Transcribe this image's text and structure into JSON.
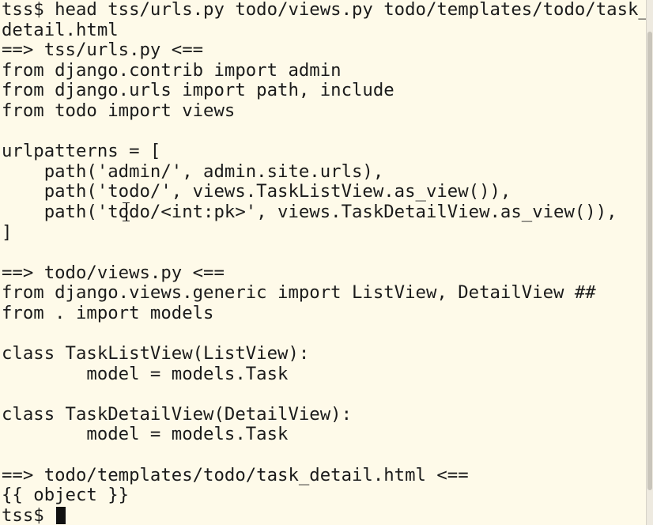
{
  "terminal": {
    "lines": [
      "tss$ head tss/urls.py todo/views.py todo/templates/todo/task_",
      "detail.html",
      "==> tss/urls.py <==",
      "from django.contrib import admin",
      "from django.urls import path, include",
      "from todo import views",
      "",
      "urlpatterns = [",
      "    path('admin/', admin.site.urls),",
      "    path('todo/', views.TaskListView.as_view()),",
      "    path('todo/<int:pk>', views.TaskDetailView.as_view()),",
      "]",
      "",
      "==> todo/views.py <==",
      "from django.views.generic import ListView, DetailView ##",
      "from . import models",
      "",
      "class TaskListView(ListView):",
      "        model = models.Task",
      "",
      "class TaskDetailView(DetailView):",
      "        model = models.Task",
      "",
      "==> todo/templates/todo/task_detail.html <==",
      "{{ object }}"
    ],
    "prompt": "tss$ "
  }
}
